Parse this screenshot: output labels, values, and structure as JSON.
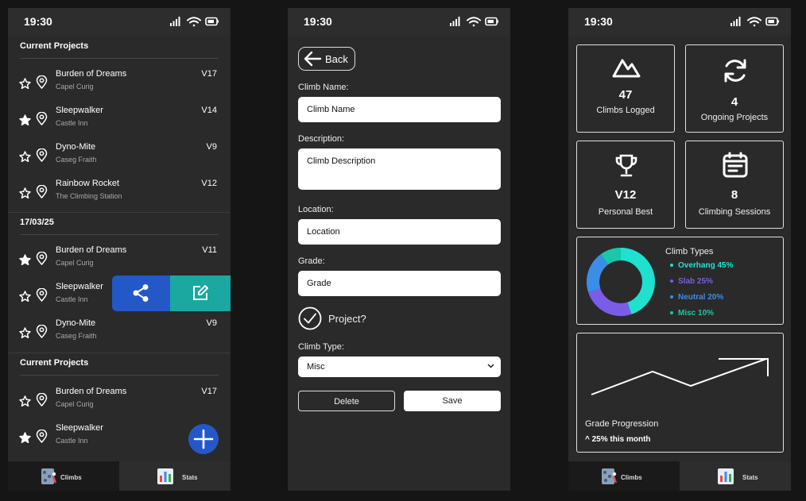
{
  "status": {
    "time": "19:30"
  },
  "list_screen": {
    "sections": [
      {
        "title": "Current Projects"
      },
      {
        "title": "17/03/25"
      },
      {
        "title": "Current Projects"
      }
    ],
    "climbs": [
      {
        "name": "Burden of Dreams",
        "location": "Capel Curig",
        "grade": "V17",
        "starred": false
      },
      {
        "name": "Sleepwalker",
        "location": "Castle Inn",
        "grade": "V14",
        "starred": true
      },
      {
        "name": "Dyno-Mite",
        "location": "Caseg Fraith",
        "grade": "V9",
        "starred": false
      },
      {
        "name": "Rainbow Rocket",
        "location": "The Climbing Station",
        "grade": "V12",
        "starred": false
      },
      {
        "name": "Burden of Dreams",
        "location": "Capel Curig",
        "grade": "V11",
        "starred": true
      },
      {
        "name": "Sleepwalker",
        "location": "Castle Inn",
        "grade": "",
        "starred": false
      },
      {
        "name": "Dyno-Mite",
        "location": "Caseg Fraith",
        "grade": "V9",
        "starred": false
      },
      {
        "name": "Burden of Dreams",
        "location": "Capel Curig",
        "grade": "V17",
        "starred": false
      },
      {
        "name": "Sleepwalker",
        "location": "Castle Inn",
        "grade": "",
        "starred": true
      }
    ],
    "swipe_actions": {
      "share_icon": "share-icon",
      "edit_icon": "edit-icon"
    },
    "fab_icon": "plus-icon"
  },
  "tabs": [
    {
      "label": "Climbs",
      "icon": "climbing-wall-icon"
    },
    {
      "label": "Stats",
      "icon": "bar-chart-icon"
    }
  ],
  "form_screen": {
    "back_label": "Back",
    "climb_name_label": "Climb Name:",
    "climb_name_placeholder": "Climb Name",
    "description_label": "Description:",
    "description_placeholder": "Climb Description",
    "location_label": "Location:",
    "location_placeholder": "Location",
    "grade_label": "Grade:",
    "grade_placeholder": "Grade",
    "project_label": "Project?",
    "climb_type_label": "Climb Type:",
    "climb_type_value": "Misc",
    "delete_label": "Delete",
    "save_label": "Save"
  },
  "stats_screen": {
    "cards": [
      {
        "value": "47",
        "caption": "Climbs Logged",
        "icon": "mountain-icon"
      },
      {
        "value": "4",
        "caption": "Ongoing Projects",
        "icon": "refresh-icon"
      },
      {
        "value": "V12",
        "caption": "Personal Best",
        "icon": "trophy-icon"
      },
      {
        "value": "8",
        "caption": "Climbing Sessions",
        "icon": "calendar-icon"
      }
    ],
    "climb_types_title": "Climb Types",
    "grade_progression_title": "Grade Progression",
    "grade_progression_sub": "^ 25% this month"
  },
  "chart_data": {
    "type": "pie",
    "title": "Climb Types",
    "categories": [
      "Overhang",
      "Slab",
      "Neutral",
      "Misc"
    ],
    "values": [
      45,
      25,
      20,
      10
    ],
    "labels": [
      "Overhang 45%",
      "Slab 25%",
      "Neutral 20%",
      "Misc 10%"
    ],
    "colors": [
      "#20e0d0",
      "#7b5ce8",
      "#3a8ee8",
      "#18c8a8"
    ]
  },
  "colors": {
    "share": "#2457c8",
    "edit": "#1aa8a0",
    "fab": "#2458c7"
  }
}
